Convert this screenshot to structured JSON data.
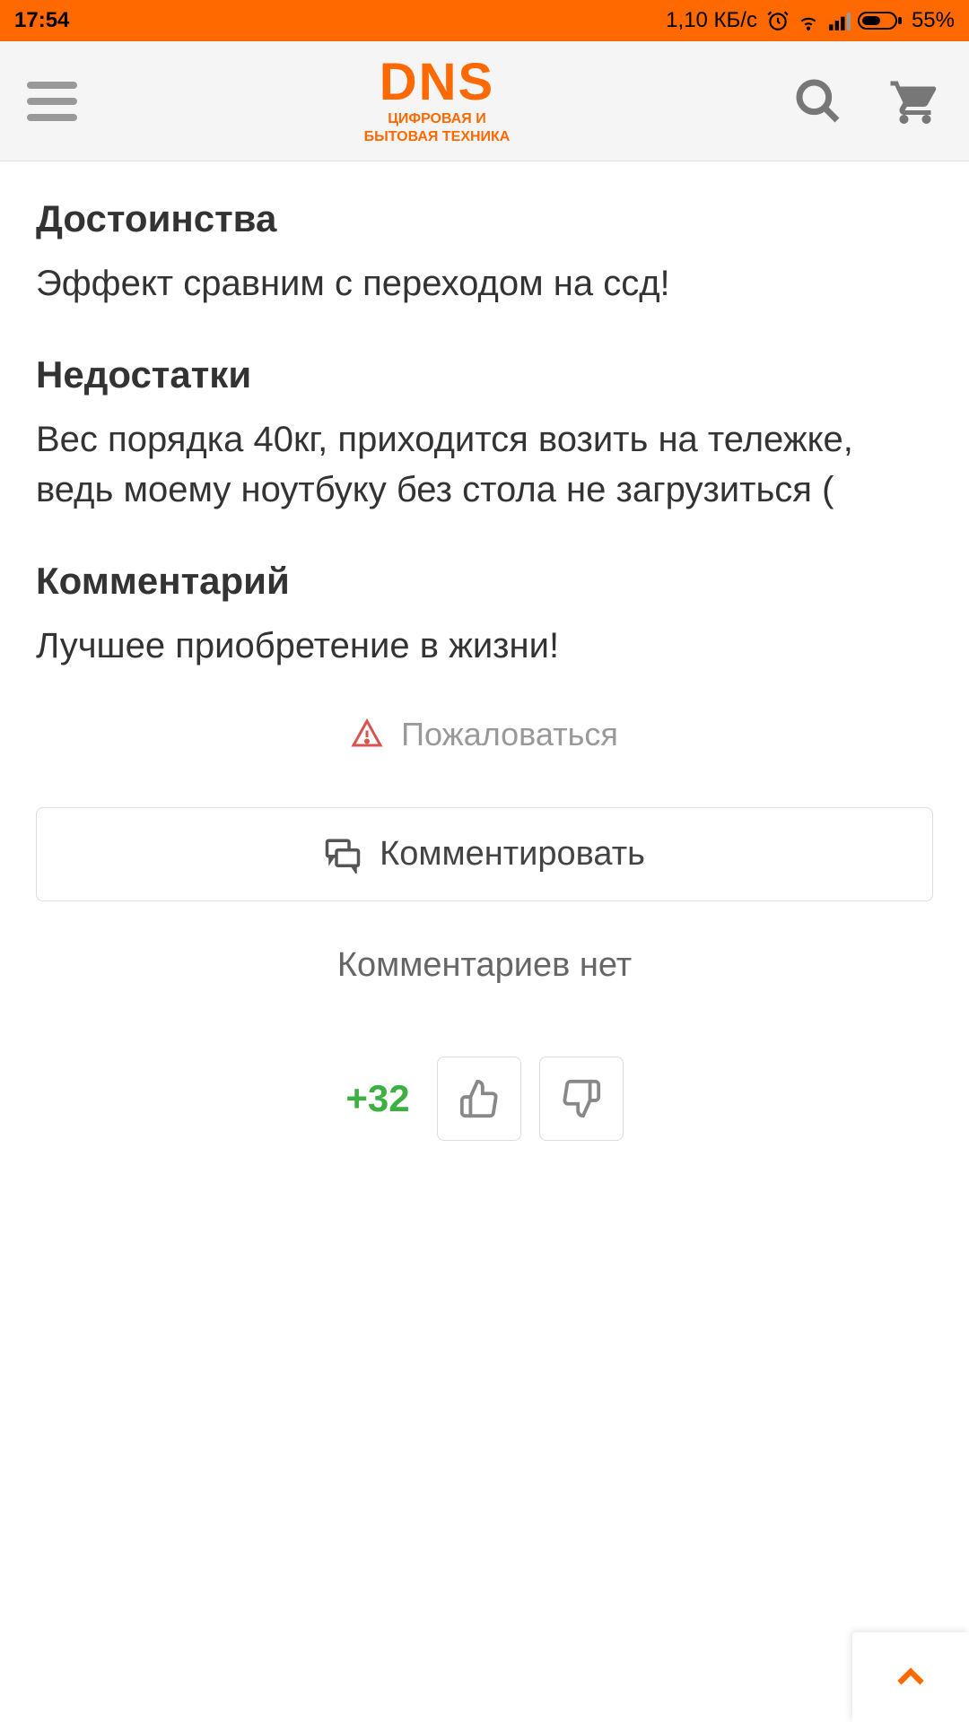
{
  "statusBar": {
    "time": "17:54",
    "dataRate": "1,10 КБ/с",
    "battery": "55%"
  },
  "header": {
    "logoMain": "DNS",
    "logoSubLine1": "ЦИФРОВАЯ И",
    "logoSubLine2": "БЫТОВАЯ ТЕХНИКА"
  },
  "review": {
    "prosTitle": "Достоинства",
    "prosText": "Эффект сравним с переходом на ссд!",
    "consTitle": "Недостатки",
    "consText": "Вес порядка 40кг, приходится возить на тележке, ведь моему ноутбуку без стола не загрузиться (",
    "commentTitle": "Комментарий",
    "commentText": "Лучшее приобретение в жизни!",
    "reportLabel": "Пожаловаться",
    "commentButtonLabel": "Комментировать",
    "noCommentsText": "Комментариев нет",
    "voteCount": "+32"
  }
}
